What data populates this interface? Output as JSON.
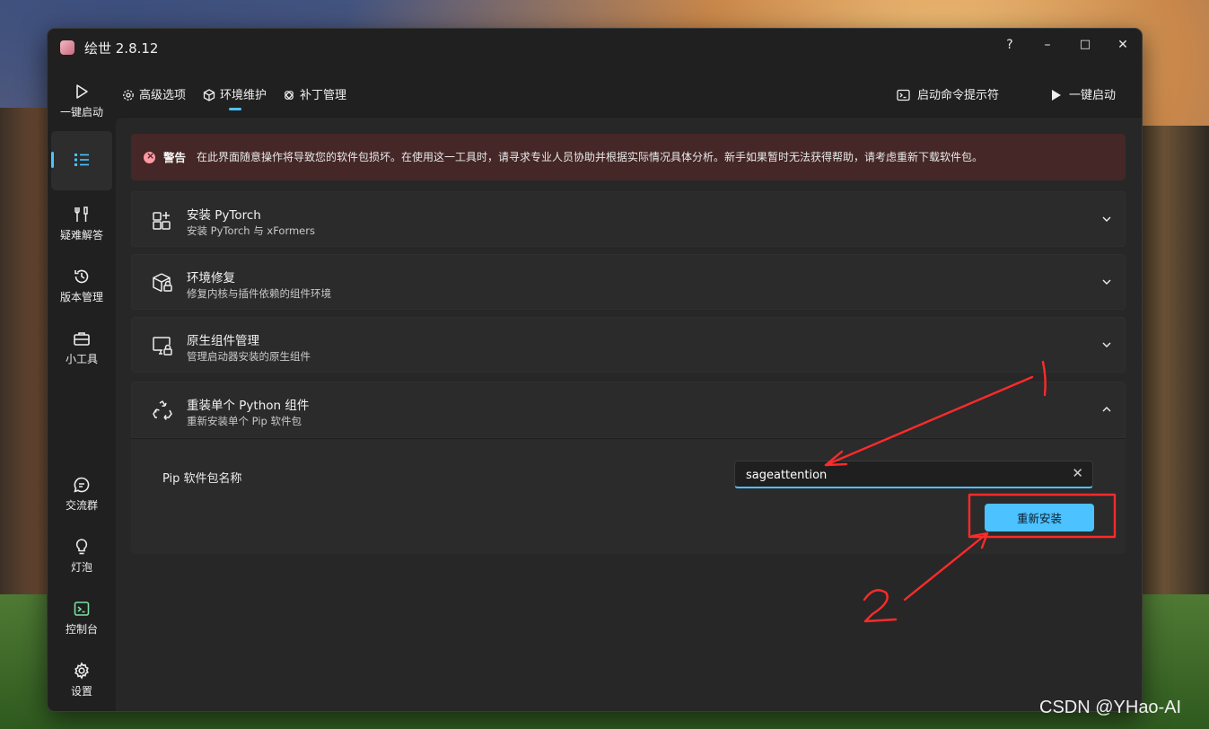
{
  "app": {
    "title": "绘世 2.8.12"
  },
  "window_controls": {
    "help": "?",
    "minimize": "–",
    "maximize": "□",
    "close": "✕"
  },
  "sidebar": {
    "items": [
      {
        "label": "一键启动",
        "icon": "play-icon"
      },
      {
        "label": "",
        "icon": "list-icon",
        "selected": true
      },
      {
        "label": "疑难解答",
        "icon": "tools-icon"
      },
      {
        "label": "版本管理",
        "icon": "history-icon"
      },
      {
        "label": "小工具",
        "icon": "toolbox-icon"
      },
      {
        "label": "交流群",
        "icon": "chat-icon"
      },
      {
        "label": "灯泡",
        "icon": "lightbulb-icon"
      },
      {
        "label": "控制台",
        "icon": "console-icon"
      },
      {
        "label": "设置",
        "icon": "gear-icon"
      }
    ]
  },
  "tabs": [
    {
      "label": "高级选项",
      "icon": "settings-icon"
    },
    {
      "label": "环境维护",
      "icon": "cube-icon",
      "active": true
    },
    {
      "label": "补丁管理",
      "icon": "patch-icon"
    }
  ],
  "toolbar": {
    "cmd_label": "启动命令提示符",
    "launch_label": "一键启动"
  },
  "warning": {
    "title": "警告",
    "text": "在此界面随意操作将导致您的软件包损坏。在使用这一工具时，请寻求专业人员协助并根据实际情况具体分析。新手如果暂时无法获得帮助，请考虑重新下载软件包。"
  },
  "cards": [
    {
      "title": "安装 PyTorch",
      "subtitle": "安装 PyTorch 与 xFormers",
      "expanded": false
    },
    {
      "title": "环境修复",
      "subtitle": "修复内核与插件依赖的组件环境",
      "expanded": false
    },
    {
      "title": "原生组件管理",
      "subtitle": "管理启动器安装的原生组件",
      "expanded": false
    },
    {
      "title": "重装单个 Python 组件",
      "subtitle": "重新安装单个 Pip 软件包",
      "expanded": true
    }
  ],
  "reinstall": {
    "field_label": "Pip 软件包名称",
    "field_value": "sageattention",
    "button_label": "重新安装"
  },
  "annotations": {
    "mark_1": "1",
    "mark_2": "2",
    "color": "#ff2a2a"
  },
  "watermark": "CSDN @YHao-AI",
  "colors": {
    "accent": "#4cc2ff",
    "warning_bg": "#442726",
    "window_bg": "#202020"
  }
}
